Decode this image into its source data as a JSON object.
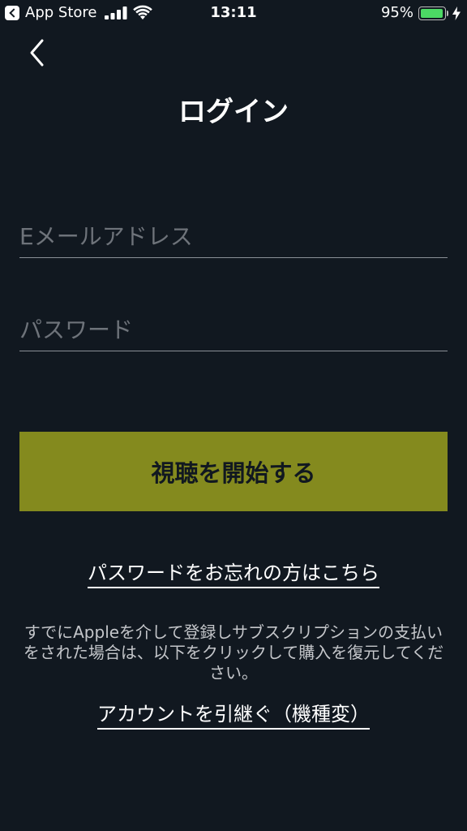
{
  "status_bar": {
    "back_app": "App Store",
    "time": "13:11",
    "battery": "95%",
    "icons": [
      "back-to-app-icon",
      "cellular-signal-icon",
      "wifi-icon",
      "battery-icon",
      "charging-bolt-icon"
    ],
    "battery_level": 0.95,
    "battery_color": "#4cd964"
  },
  "nav": {
    "back_icon": "chevron-left-icon",
    "title": "ログイン"
  },
  "form": {
    "email_placeholder": "Eメールアドレス",
    "email_value": "",
    "password_placeholder": "パスワード",
    "password_value": ""
  },
  "actions": {
    "start_label": "視聴を開始する",
    "start_color": "#848a1e",
    "forgot_password": "パスワードをお忘れの方はこちら",
    "notice": "すでにAppleを介して登録しサブスクリプションの支払いをされた場合は、以下をクリックして購入を復元してください。",
    "transfer_account": "アカウントを引継ぐ（機種変）"
  },
  "theme": {
    "background": "#111820"
  }
}
